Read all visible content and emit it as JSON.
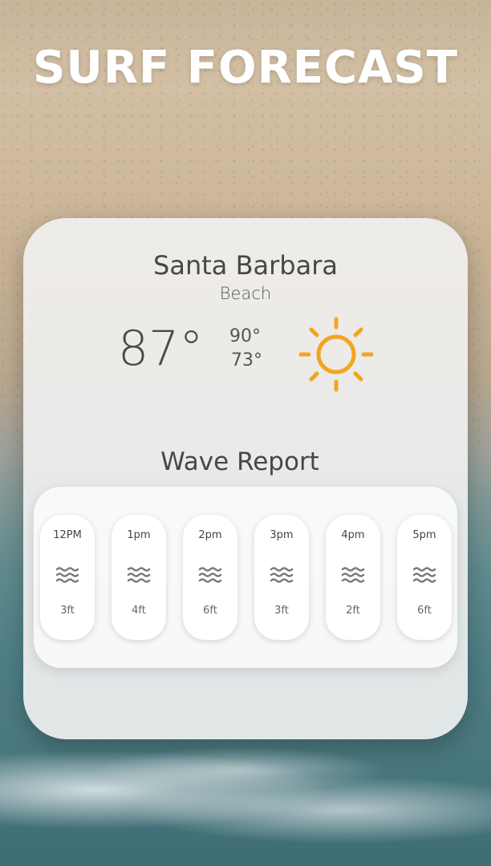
{
  "app": {
    "title": "SURF FORECAST"
  },
  "location": {
    "city": "Santa Barbara",
    "place": "Beach"
  },
  "weather": {
    "current": "87°",
    "high": "90°",
    "low": "73°",
    "icon": "sun-icon",
    "icon_color": "#f2a51f"
  },
  "wave_report": {
    "title": "Wave Report",
    "slots": [
      {
        "time": "12PM",
        "height": "3ft",
        "icon": "wave-icon"
      },
      {
        "time": "1pm",
        "height": "4ft",
        "icon": "wave-icon"
      },
      {
        "time": "2pm",
        "height": "6ft",
        "icon": "wave-icon"
      },
      {
        "time": "3pm",
        "height": "3ft",
        "icon": "wave-icon"
      },
      {
        "time": "4pm",
        "height": "2ft",
        "icon": "wave-icon"
      },
      {
        "time": "5pm",
        "height": "6ft",
        "icon": "wave-icon"
      }
    ]
  }
}
